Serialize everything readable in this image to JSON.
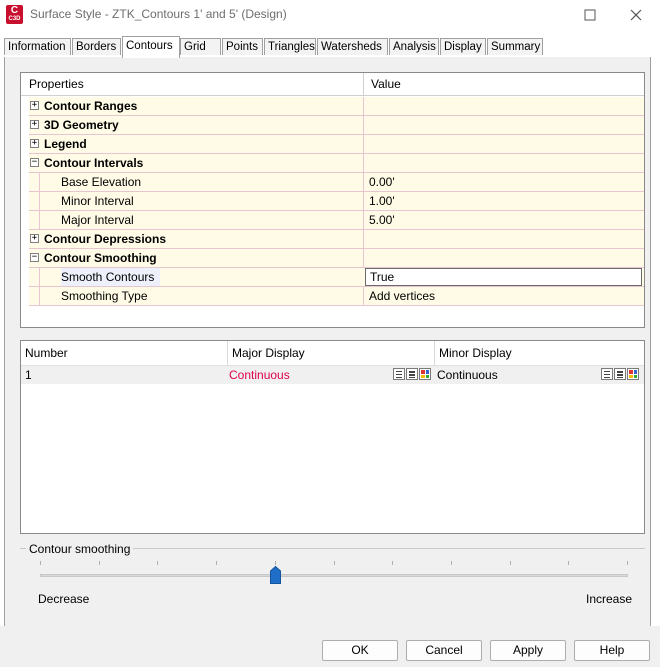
{
  "window": {
    "icon_text_top": "C",
    "icon_text_bottom": "C3D",
    "title": "Surface Style - ZTK_Contours 1' and 5' (Design)",
    "accent_color": "#c8102e"
  },
  "tabs": [
    {
      "label": "Information"
    },
    {
      "label": "Borders"
    },
    {
      "label": "Contours",
      "active": true
    },
    {
      "label": "Grid"
    },
    {
      "label": "Points"
    },
    {
      "label": "Triangles"
    },
    {
      "label": "Watersheds"
    },
    {
      "label": "Analysis"
    },
    {
      "label": "Display"
    },
    {
      "label": "Summary"
    }
  ],
  "properties": {
    "header_property": "Properties",
    "header_value": "Value",
    "groups": {
      "contour_ranges": {
        "label": "Contour Ranges",
        "expander": "+"
      },
      "geometry_3d": {
        "label": "3D Geometry",
        "expander": "+"
      },
      "legend": {
        "label": "Legend",
        "expander": "+"
      },
      "contour_intervals": {
        "label": "Contour Intervals",
        "expander": "−",
        "items": [
          {
            "name": "Base Elevation",
            "value": "0.00'"
          },
          {
            "name": "Minor Interval",
            "value": "1.00'"
          },
          {
            "name": "Major Interval",
            "value": "5.00'"
          }
        ]
      },
      "contour_depressions": {
        "label": "Contour Depressions",
        "expander": "+"
      },
      "contour_smoothing": {
        "label": "Contour Smoothing",
        "expander": "−",
        "items": [
          {
            "name": "Smooth Contours",
            "value": "True"
          },
          {
            "name": "Smoothing Type",
            "value": "Add vertices"
          }
        ]
      }
    }
  },
  "display_grid": {
    "headers": [
      "Number",
      "Major Display",
      "Minor Display"
    ],
    "rows": [
      {
        "number": "1",
        "major": "Continuous",
        "minor": "Continuous"
      }
    ],
    "major_text_color": "#e0004d"
  },
  "smoothing": {
    "group_label": "Contour smoothing",
    "decrease_label": "Decrease",
    "increase_label": "Increase",
    "level_fraction": 0.4,
    "thumb_color": "#1f6fc8"
  },
  "buttons": {
    "ok": "OK",
    "cancel": "Cancel",
    "apply": "Apply",
    "help": "Help"
  }
}
